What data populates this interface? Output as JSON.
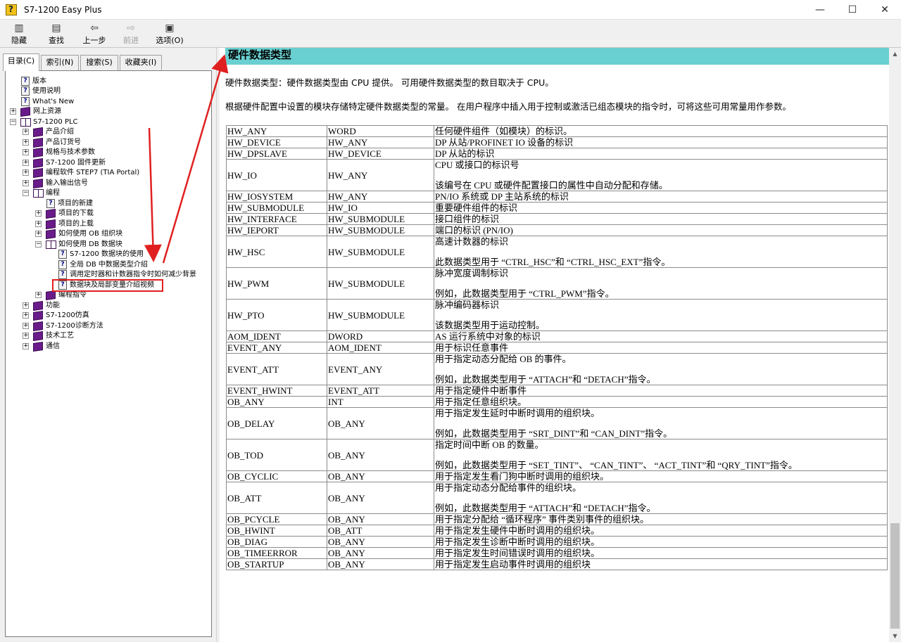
{
  "window": {
    "title": "S7-1200 Easy Plus",
    "minimize": "—",
    "maximize": "☐",
    "close": "✕"
  },
  "toolbar": {
    "hide": "隐藏",
    "find": "查找",
    "back": "上一步",
    "forward": "前进",
    "options": "选项(O)"
  },
  "tabs": {
    "contents": "目录(C)",
    "index": "索引(N)",
    "search": "搜索(S)",
    "favorites": "收藏夹(I)"
  },
  "tree": {
    "version": "版本",
    "usage": "使用说明",
    "whats_new": "What's New",
    "web": "网上资源",
    "plc": "S7-1200 PLC",
    "intro": "产品介绍",
    "order": "产品订货号",
    "specs": "规格与技术参数",
    "firmware": "S7-1200 固件更新",
    "software": "编程软件 STEP7 (TIA Portal)",
    "io": "输入输出信号",
    "programming": "编程",
    "new_project": "项目的新建",
    "download": "项目的下载",
    "upload": "项目的上载",
    "ob": "如何使用 OB 组织块",
    "db": "如何使用 DB 数据块",
    "db_usage": "S7-1200 数据块的使用",
    "global_db": "全局 DB 中数据类型介绍",
    "timer": "调用定时器和计数器指令时如何减少背景",
    "video": "数据块及局部变量介绍视频",
    "instructions": "编程指令",
    "functions": "功能",
    "sim": "S7-1200仿真",
    "diag": "S7-1200诊断方法",
    "tech": "技术工艺",
    "comm": "通信"
  },
  "content": {
    "heading": "硬件数据类型",
    "para1": "硬件数据类型：硬件数据类型由  CPU 提供。  可用硬件数据类型的数目取决于  CPU。",
    "para2": "根据硬件配置中设置的模块存储特定硬件数据类型的常量。  在用户程序中插入用于控制或激活已组态模块的指令时，可将这些可用常量用作参数。",
    "rows": [
      {
        "name": "HW_ANY",
        "base": "WORD",
        "desc": "任何硬件组件（如模块）的标识。"
      },
      {
        "name": "HW_DEVICE",
        "base": "HW_ANY",
        "desc": "DP 从站/PROFINET IO 设备的标识"
      },
      {
        "name": "HW_DPSLAVE",
        "base": "HW_DEVICE",
        "desc": "DP 从站的标识"
      },
      {
        "name": "HW_IO",
        "base": "HW_ANY",
        "desc": "CPU 或接口的标识号",
        "desc2": "该编号在  CPU 或硬件配置接口的属性中自动分配和存储。"
      },
      {
        "name": "HW_IOSYSTEM",
        "base": "HW_ANY",
        "desc": "PN/IO 系统或  DP 主站系统的标识"
      },
      {
        "name": "HW_SUBMODULE",
        "base": "HW_IO",
        "desc": "重要硬件组件的标识"
      },
      {
        "name": "HW_INTERFACE",
        "base": "HW_SUBMODULE",
        "desc": "接口组件的标识"
      },
      {
        "name": "HW_IEPORT",
        "base": "HW_SUBMODULE",
        "desc": "端口的标识  (PN/IO)"
      },
      {
        "name": "HW_HSC",
        "base": "HW_SUBMODULE",
        "desc": "高速计数器的标识",
        "desc2": "此数据类型用于  “CTRL_HSC”和  “CTRL_HSC_EXT”指令。"
      },
      {
        "name": "HW_PWM",
        "base": "HW_SUBMODULE",
        "desc": "脉冲宽度调制标识",
        "desc2": "例如，此数据类型用于  “CTRL_PWM”指令。"
      },
      {
        "name": "HW_PTO",
        "base": "HW_SUBMODULE",
        "desc": "脉冲编码器标识",
        "desc2": "该数据类型用于运动控制。"
      },
      {
        "name": "AOM_IDENT",
        "base": "DWORD",
        "desc": "AS 运行系统中对象的标识"
      },
      {
        "name": "EVENT_ANY",
        "base": "AOM_IDENT",
        "desc": "用于标识任意事件"
      },
      {
        "name": "EVENT_ATT",
        "base": "EVENT_ANY",
        "desc": "用于指定动态分配给  OB 的事件。",
        "desc2": "例如，此数据类型用于  “ATTACH”和  “DETACH”指令。"
      },
      {
        "name": "EVENT_HWINT",
        "base": "EVENT_ATT",
        "desc": "用于指定硬件中断事件"
      },
      {
        "name": "OB_ANY",
        "base": "INT",
        "desc": "用于指定任意组织块。"
      },
      {
        "name": "OB_DELAY",
        "base": "OB_ANY",
        "desc": "用于指定发生延时中断时调用的组织块。",
        "desc2": "例如，此数据类型用于  “SRT_DINT”和  “CAN_DINT”指令。"
      },
      {
        "name": "OB_TOD",
        "base": "OB_ANY",
        "desc": "指定时间中断  OB 的数量。",
        "desc2": "例如，此数据类型用于  “SET_TINT”、  “CAN_TINT”、  “ACT_TINT”和  “QRY_TINT”指令。"
      },
      {
        "name": "OB_CYCLIC",
        "base": "OB_ANY",
        "desc": "用于指定发生看门狗中断时调用的组织块。"
      },
      {
        "name": "OB_ATT",
        "base": "OB_ANY",
        "desc": "用于指定动态分配给事件的组织块。",
        "desc2": "例如，此数据类型用于  “ATTACH”和  “DETACH”指令。"
      },
      {
        "name": "OB_PCYCLE",
        "base": "OB_ANY",
        "desc": "用于指定分配给  “循环程序”  事件类别事件的组织块。"
      },
      {
        "name": "OB_HWINT",
        "base": "OB_ATT",
        "desc": "用于指定发生硬件中断时调用的组织块。"
      },
      {
        "name": "OB_DIAG",
        "base": "OB_ANY",
        "desc": "用于指定发生诊断中断时调用的组织块。"
      },
      {
        "name": "OB_TIMEERROR",
        "base": "OB_ANY",
        "desc": "用于指定发生时间错误时调用的组织块。"
      },
      {
        "name": "OB_STARTUP",
        "base": "OB_ANY",
        "desc": "用于指定发生启动事件时调用的组织块"
      }
    ]
  },
  "accent": {
    "heading_bg": "#6acfd0",
    "annotation": "#e02020",
    "book": "#6a1b8a"
  }
}
